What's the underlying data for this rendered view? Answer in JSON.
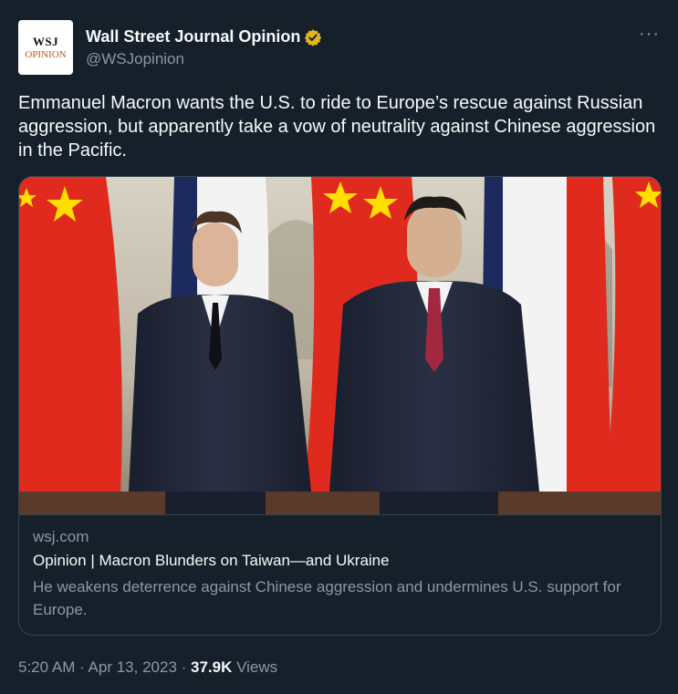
{
  "author": {
    "display_name": "Wall Street Journal Opinion",
    "handle": "@WSJopinion",
    "avatar_line1": "WSJ",
    "avatar_line2": "OPINION",
    "verified_color": "#e2b719"
  },
  "more_menu": "···",
  "tweet": {
    "text": "Emmanuel Macron wants the U.S. to ride to Europe’s rescue against Russian aggression, but apparently take a vow of neutrality against Chinese aggression in the Pacific."
  },
  "card": {
    "domain": "wsj.com",
    "title": "Opinion | Macron Blunders on Taiwan—and Ukraine",
    "description": "He weakens deterrence against Chinese aggression and undermines U.S. support for Europe."
  },
  "meta": {
    "time": "5:20 AM",
    "separator": " · ",
    "date": "Apr 13, 2023",
    "views_count": "37.9K",
    "views_label": " Views"
  },
  "colors": {
    "background": "#15202b",
    "text_primary": "#f7f9f9",
    "text_secondary": "#8b98a5",
    "border": "#38444d"
  }
}
